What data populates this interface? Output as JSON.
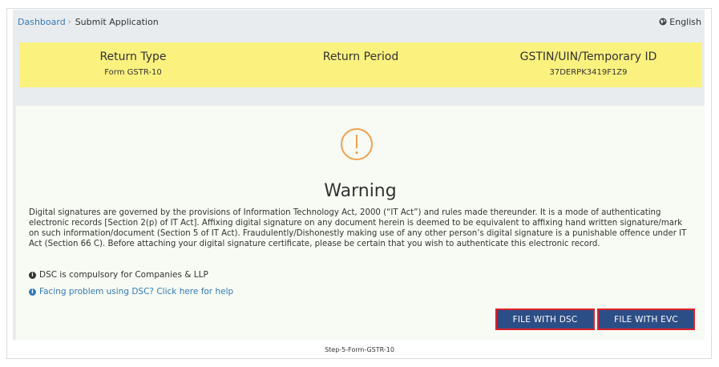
{
  "breadcrumb": {
    "dashboard": "Dashboard",
    "separator": "›",
    "current": "Submit Application"
  },
  "language": {
    "label": "English",
    "icon": "globe-icon"
  },
  "header": {
    "columns": [
      {
        "heading": "Return Type",
        "value": "Form GSTR-10"
      },
      {
        "heading": "Return Period",
        "value": ""
      },
      {
        "heading": "GSTIN/UIN/Temporary ID",
        "value": "37DERPK3419F1Z9"
      }
    ]
  },
  "warning": {
    "icon": "exclamation-circle-icon",
    "title": "Warning",
    "text": "Digital signatures are governed by the provisions of Information Technology Act, 2000 (“IT Act”) and rules made thereunder. It is a mode of authenticating electronic records [Section 2(p) of IT Act]. Affixing digital signature on any document herein is deemed to be equivalent to affixing hand written signature/mark on such information/document (Section 5 of IT Act). Fraudulently/Dishonestly making use of any other person’s digital signature is a punishable offence under IT Act (Section 66 C). Before attaching your digital signature certificate, please be certain that you wish to authenticate this electronic record."
  },
  "info": {
    "dsc_compulsory": "DSC is compulsory for Companies & LLP",
    "dsc_help": "Facing problem using DSC? Click here for help"
  },
  "buttons": {
    "file_dsc": "FILE WITH DSC",
    "file_evc": "FILE WITH EVC"
  },
  "caption": "Step-5-Form-GSTR-10",
  "colors": {
    "accent_blue": "#2c4e86",
    "link": "#337ab7",
    "highlight_border": "#e0202a",
    "header_yellow": "#faf17f",
    "warning_orange": "#f0a050"
  }
}
